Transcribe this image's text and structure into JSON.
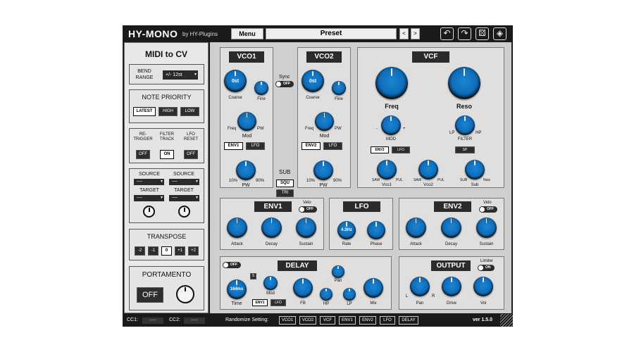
{
  "header": {
    "logo": "HY-MONO",
    "by": "by HY-Plugins",
    "menu": "Menu",
    "preset": "Preset",
    "prev": "<",
    "next": ">"
  },
  "midi": {
    "title": "MIDI to CV",
    "bend_label": "BEND RANGE",
    "bend_value": "+/- 12st",
    "np_title": "NOTE PRIORITY",
    "np_options": [
      "LATEST",
      "HIGH",
      "LOW"
    ],
    "np_selected": "LATEST",
    "retrigger": "RE- TRIGGER",
    "filter_track": "FILTER TRACK",
    "lfo_reset": "LFO RESET",
    "retrigger_state": "OFF",
    "filter_track_state": "ON",
    "lfo_reset_state": "OFF",
    "source1_label": "SOURCE",
    "source2_label": "SOURCE",
    "target1_label": "TARGET",
    "target2_label": "TARGET",
    "source1": "----",
    "source2": "----",
    "target1": "----",
    "target2": "----",
    "transpose_title": "TRANSPOSE",
    "transpose": [
      "-2",
      "-1",
      "0",
      "+1",
      "+2"
    ],
    "transpose_selected": "0",
    "portamento_title": "PORTAMENTO",
    "portamento_state": "OFF"
  },
  "vco1": {
    "title": "VCO1",
    "coarse_val": "0st",
    "coarse": "Coarse",
    "fine": "Fine",
    "freq": "Freq",
    "pw_short": "PW",
    "mod": "Mod",
    "env": "ENV1",
    "lfo": "LFO",
    "pw": "PW",
    "pw_min": "10%",
    "pw_max": "90%"
  },
  "vco2": {
    "title": "VCO2",
    "coarse_val": "0st",
    "coarse": "Coarse",
    "fine": "Fine",
    "freq": "Freq",
    "pw_short": "PW",
    "mod": "Mod",
    "env": "ENV2",
    "lfo": "LFO",
    "pw": "PW",
    "pw_min": "10%",
    "pw_max": "90%"
  },
  "sync": {
    "label": "Sync",
    "state": "OFF"
  },
  "sub": {
    "label": "SUB",
    "options": [
      "SQU",
      "TRI"
    ],
    "selected": "SQU"
  },
  "vcf": {
    "title": "VCF",
    "freq": "Freq",
    "reso": "Reso",
    "mod": "MOD",
    "mod_min": "-",
    "mod_max": "+",
    "filter": "FILTER",
    "lp": "LP",
    "hp": "HP",
    "env": "ENV2",
    "lfo": "LFO",
    "slope": "SP",
    "vco1": "Vco1",
    "vco2": "Vco2",
    "sub": "Sub",
    "saw": "SAW",
    "pul": "PUL",
    "sub_l": "SUB",
    "noiz": "Noiz"
  },
  "env1": {
    "title": "ENV1",
    "velo": "Velo",
    "velo_state": "OFF",
    "knobs": [
      "Attack",
      "Decay",
      "Sustain"
    ]
  },
  "lfo": {
    "title": "LFO",
    "rate_val": "4.3Hz",
    "knobs": [
      "Rate",
      "Phase"
    ]
  },
  "env2": {
    "title": "ENV2",
    "velo": "Velo",
    "velo_state": "OFF",
    "knobs": [
      "Attack",
      "Decay",
      "Sustain"
    ]
  },
  "delay": {
    "title": "DELAY",
    "state": "OFF",
    "time_val": "164ms",
    "time": "Time",
    "mod": "Mod",
    "env": "ENV1",
    "lfo": "LFO",
    "fb": "FB",
    "pan": "Pan",
    "hp": "HP",
    "lp": "LP",
    "mix": "Mix",
    "sync": "S"
  },
  "output": {
    "title": "OUTPUT",
    "limiter": "Limiter",
    "limiter_state": "ON",
    "pan": "Pan",
    "pan_l": "L",
    "pan_r": "R",
    "drive": "Drive",
    "vol": "Vol"
  },
  "footer": {
    "cc1": "CC1:",
    "cc2": "CC2:",
    "cc1_val": "-----",
    "cc2_val": "-----",
    "randomize": "Randomize Setting:",
    "buttons": [
      "VCO1",
      "VCO2",
      "VCF",
      "ENV1",
      "ENV2",
      "LFO",
      "DELAY"
    ],
    "version": "ver 1.5.0"
  },
  "colors": {
    "knob": "#0f6cb8",
    "panel": "#dfdfdf",
    "frame": "#1e1e1e"
  }
}
